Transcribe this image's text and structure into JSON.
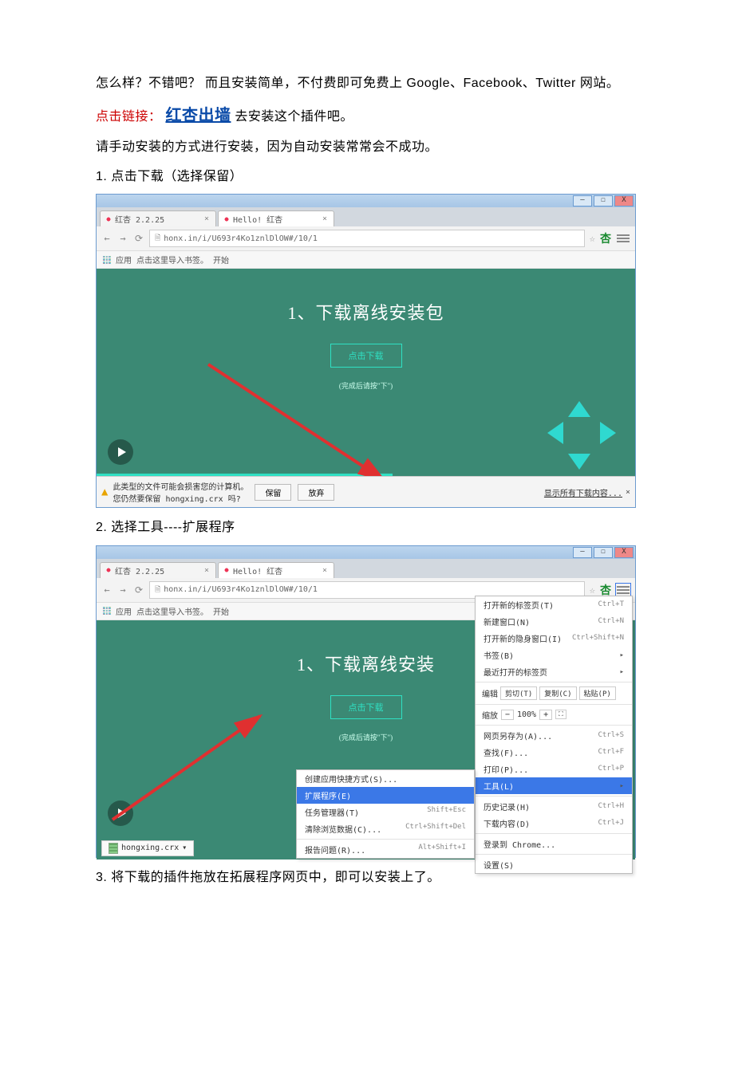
{
  "text": {
    "intro": "怎么样？不错吧？  而且安装简单，不付费即可免费上 Google、Facebook、Twitter 网站。",
    "link_prefix": "点击链接：",
    "link_name": "红杏出墙",
    "link_suffix": "  去安装这个插件吧。",
    "manual": "请手动安装的方式进行安装，因为自动安装常常会不成功。",
    "step1": "1. 点击下载（选择保留）",
    "step2": "2. 选择工具----扩展程序",
    "step3": "3. 将下载的插件拖放在拓展程序网页中，即可以安装上了。"
  },
  "browser": {
    "tab1": "红杏 2.2.25",
    "tab2": "Hello! 红杏",
    "url": "honx.in/i/U693r4Ko1znlDlOW#/10/1",
    "bm_apps": "应用",
    "bm_import": "点击这里导入书签。",
    "bm_start": "开始",
    "page_title": "1、下载离线安装包",
    "page_short": "1、下载离线安装",
    "btn_download": "点击下载",
    "hint": "(完成后请按\"下\")",
    "dl_warn_l1": "此类型的文件可能会损害您的计算机。",
    "dl_warn_l2": "您仍然要保留 hongxing.crx 吗?",
    "keep": "保留",
    "discard": "放弃",
    "show_all": "显示所有下载内容...",
    "dl_file": "hongxing.crx"
  },
  "menu": {
    "new_tab": "打开新的标签页(T)",
    "k_new_tab": "Ctrl+T",
    "new_win": "新建窗口(N)",
    "k_new_win": "Ctrl+N",
    "incog": "打开新的隐身窗口(I)",
    "k_incog": "Ctrl+Shift+N",
    "bookmarks": "书签(B)",
    "recent": "最近打开的标签页",
    "edit": "编辑",
    "cut": "剪切(T)",
    "copy": "复制(C)",
    "paste": "粘贴(P)",
    "zoom": "缩放",
    "zoom_val": "100%",
    "save_as": "网页另存为(A)...",
    "k_save": "Ctrl+S",
    "find": "查找(F)...",
    "k_find": "Ctrl+F",
    "print": "打印(P)...",
    "k_print": "Ctrl+P",
    "tools": "工具(L)",
    "history": "历史记录(H)",
    "k_hist": "Ctrl+H",
    "downloads": "下载内容(D)",
    "k_dl": "Ctrl+J",
    "signin": "登录到 Chrome...",
    "settings": "设置(S)"
  },
  "submenu": {
    "create_shortcut": "创建应用快捷方式(S)...",
    "extensions": "扩展程序(E)",
    "task_mgr": "任务管理器(T)",
    "k_task": "Shift+Esc",
    "clear": "清除浏览数据(C)...",
    "k_clear": "Ctrl+Shift+Del",
    "report": "报告问题(R)...",
    "k_report": "Alt+Shift+I"
  },
  "win": {
    "min": "–",
    "max": "☐",
    "close": "X"
  }
}
